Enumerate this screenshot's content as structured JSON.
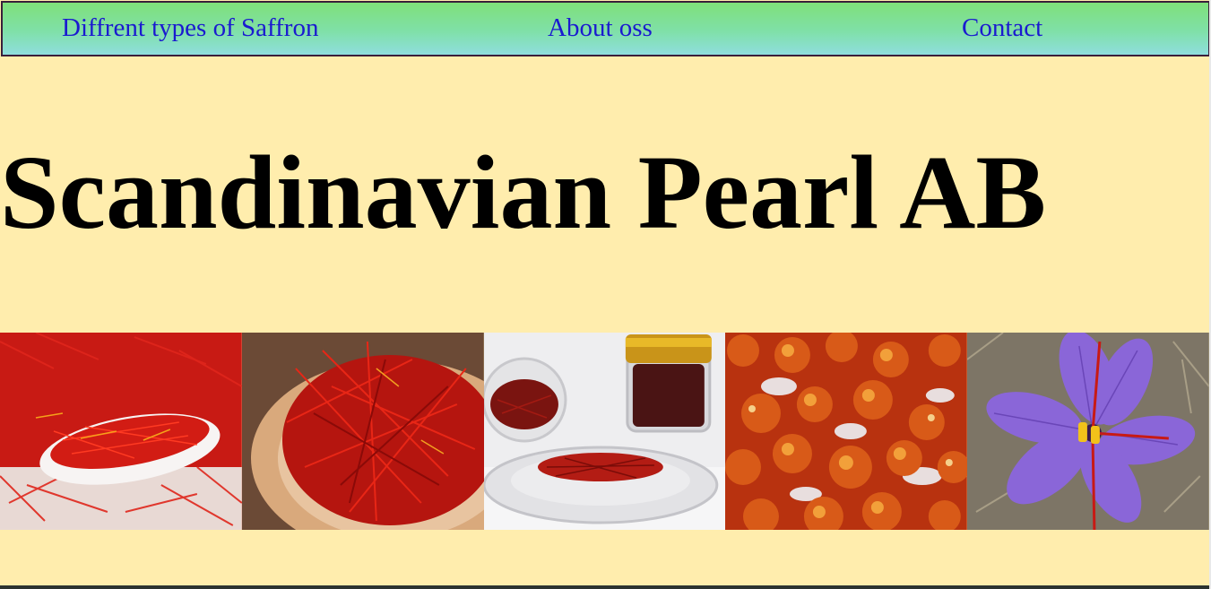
{
  "nav": {
    "items": [
      {
        "label": "Diffrent types of Saffron"
      },
      {
        "label": "About oss"
      },
      {
        "label": "Contact"
      }
    ]
  },
  "hero": {
    "title": "Scandinavian Pearl AB"
  },
  "gallery": {
    "images": [
      {
        "subject": "saffron threads in white bowl"
      },
      {
        "subject": "saffron threads on wooden plate"
      },
      {
        "subject": "saffron in glass jars and dish"
      },
      {
        "subject": "saffron stigma bundles"
      },
      {
        "subject": "purple crocus saffron flower"
      }
    ]
  },
  "colors": {
    "page_background": "#ffedad",
    "nav_gradient_top": "#7fe07a",
    "nav_gradient_bottom": "#8fdede",
    "nav_link": "#1a1ad0",
    "nav_border": "#3a1e3a",
    "title": "#000000"
  }
}
